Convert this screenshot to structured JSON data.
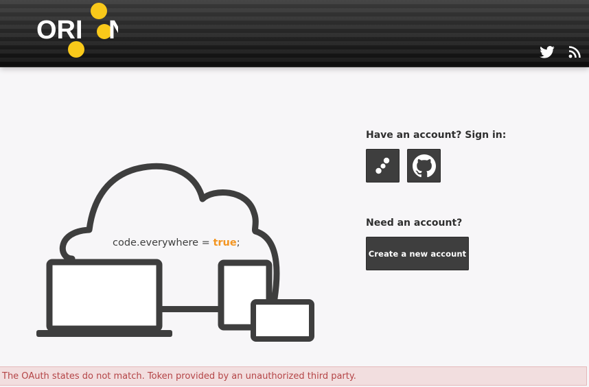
{
  "header": {
    "logo_text": "ORION",
    "icons": {
      "twitter": "twitter-icon",
      "rss": "rss-icon"
    }
  },
  "illustration": {
    "code_prefix": "code.everywhere = ",
    "code_value": "true",
    "code_suffix": ";"
  },
  "signin": {
    "title": "Have an account? Sign in:",
    "providers": [
      {
        "name": "Orion",
        "icon": "orion-dots-icon"
      },
      {
        "name": "GitHub",
        "icon": "github-icon"
      }
    ]
  },
  "register": {
    "title": "Need an account?",
    "create_label": "Create a new account"
  },
  "error": {
    "message": "The OAuth states do not match. Token provided by an unauthorized third party."
  },
  "colors": {
    "accent_yellow": "#f9c91a",
    "accent_orange": "#f39521",
    "error_text": "#b44446",
    "error_bg": "#f2dedf",
    "button_bg": "#3e3e3e"
  }
}
